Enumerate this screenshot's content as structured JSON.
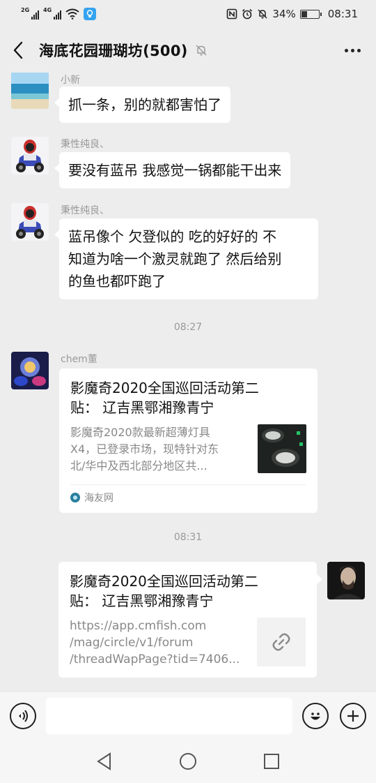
{
  "status_bar": {
    "signal1_label": "2G",
    "signal2_label": "4G",
    "battery": "34%",
    "battery_level": 0.34,
    "time": "08:31"
  },
  "header": {
    "title": "海底花园珊瑚坊(500)",
    "icons": [
      "back-arrow-icon",
      "mute-bell-icon",
      "more-dots-icon"
    ]
  },
  "messages": [
    {
      "sender": "小新",
      "text": "抓一条，别的就都害怕了",
      "avatar": "beach-photo"
    },
    {
      "sender": "秉性纯良、",
      "text": "要没有蓝吊 我感觉一锅都能干出来",
      "avatar": "motorcycle-rider"
    },
    {
      "sender": "秉性纯良、",
      "lines": [
        "蓝吊像个 欠登似的  吃的好好的 不",
        "知道为啥一个激灵就跑了 然后给别",
        "的鱼也都吓跑了"
      ],
      "avatar": "motorcycle-rider"
    }
  ],
  "time_dividers": [
    "08:27",
    "08:31"
  ],
  "link_card_1": {
    "sender": "chem董",
    "title_lines": [
      "影魔奇2020全国巡回活动第二",
      "贴：  辽吉黑鄂湘豫青宁"
    ],
    "desc_lines": [
      "影魔奇2020款最新超薄灯具",
      "X4，已登录市场，现特针对东",
      "北/华中及西北部分地区共..."
    ],
    "source": "海友网"
  },
  "link_card_2": {
    "title_lines": [
      "影魔奇2020全国巡回活动第二",
      "贴：  辽吉黑鄂湘豫青宁"
    ],
    "url_lines": [
      "https://app.cmfish.com",
      "/mag/circle/v1/forum",
      "/threadWapPage?tid=7406..."
    ],
    "thumb_icon": "link-icon"
  },
  "input_bar": {
    "placeholder": "",
    "icons": [
      "voice-icon",
      "emoji-icon",
      "plus-icon"
    ]
  },
  "nav": {
    "icons": [
      "nav-back-icon",
      "nav-home-icon",
      "nav-recents-icon"
    ]
  },
  "colors": {
    "background": "#ededed",
    "bubble": "#ffffff",
    "muted_text": "#999999"
  }
}
